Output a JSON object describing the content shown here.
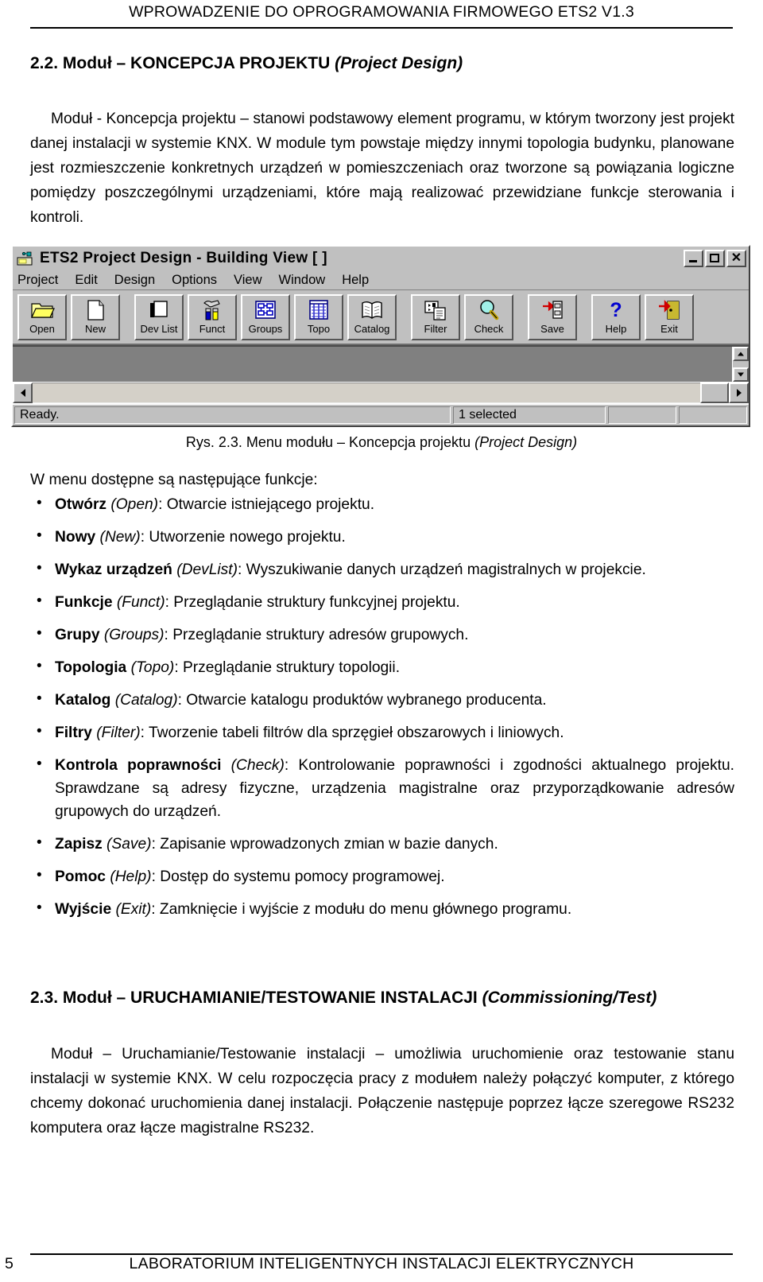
{
  "header": {
    "running_title": "WPROWADZENIE DO OPROGRAMOWANIA FIRMOWEGO  ETS2 V1.3"
  },
  "section_22": {
    "number": "2.2.",
    "title_pl": "Moduł – KONCEPCJA PROJEKTU",
    "title_en": "(Project Design)",
    "paragraph": "Moduł - Koncepcja projektu – stanowi podstawowy element programu, w którym tworzony jest projekt danej instalacji w systemie KNX. W module tym powstaje między innymi topologia budynku, planowane jest rozmieszczenie konkretnych urządzeń w pomieszczeniach oraz tworzone są powiązania logiczne pomiędzy poszczególnymi urządzeniami, które mają realizować przewidziane funkcje sterowania i kontroli."
  },
  "figure": {
    "caption_pl": "Rys. 2.3. Menu modułu – Koncepcja projektu ",
    "caption_en": "(Project Design)",
    "window": {
      "title": "ETS2 Project Design - Building View [ ]",
      "app_icon": "ets2-app-icon",
      "caption_buttons": [
        {
          "name": "minimize-button",
          "glyph": "minimize-icon"
        },
        {
          "name": "maximize-button",
          "glyph": "maximize-icon"
        },
        {
          "name": "close-button",
          "glyph": "close-icon",
          "label": "✕"
        }
      ],
      "menu": [
        {
          "label": "Project"
        },
        {
          "label": "Edit"
        },
        {
          "label": "Design"
        },
        {
          "label": "Options"
        },
        {
          "label": "View"
        },
        {
          "label": "Window"
        },
        {
          "label": "Help"
        }
      ],
      "toolbar": [
        {
          "label": "Open",
          "icon": "open-folder-icon"
        },
        {
          "label": "New",
          "icon": "new-document-icon"
        },
        {
          "separator_after": true
        },
        {
          "label": "Dev List",
          "icon": "device-list-icon"
        },
        {
          "label": "Funct",
          "icon": "function-tools-icon"
        },
        {
          "label": "Groups",
          "icon": "group-addresses-icon"
        },
        {
          "label": "Topo",
          "icon": "topology-grid-icon"
        },
        {
          "label": "Catalog",
          "icon": "catalog-book-icon"
        },
        {
          "separator_after": true
        },
        {
          "label": "Filter",
          "icon": "filter-table-icon"
        },
        {
          "label": "Check",
          "icon": "magnifier-check-icon"
        },
        {
          "separator_after": true
        },
        {
          "label": "Save",
          "icon": "save-disk-icon"
        },
        {
          "separator_after": true
        },
        {
          "label": "Help",
          "icon": "question-mark-icon"
        },
        {
          "label": "Exit",
          "icon": "exit-door-icon"
        }
      ],
      "statusbar": {
        "ready": "Ready.",
        "selection": "1 selected",
        "field_x": "",
        "field_y": ""
      },
      "colors": {
        "face": "#c0c0c0",
        "client": "#808080",
        "shadow": "#555555",
        "highlight": "#ffffff"
      }
    }
  },
  "menu_intro": "W menu dostępne są następujące funkcje:",
  "functions": [
    {
      "pl": "Otwórz ",
      "en": "(Open)",
      "desc": ": Otwarcie istniejącego projektu."
    },
    {
      "pl": "Nowy ",
      "en": "(New)",
      "desc": ": Utworzenie nowego projektu."
    },
    {
      "pl": "Wykaz urządzeń ",
      "en": "(DevList)",
      "desc": ": Wyszukiwanie danych urządzeń magistralnych w projekcie."
    },
    {
      "pl": "Funkcje ",
      "en": "(Funct)",
      "desc": ": Przeglądanie struktury funkcyjnej projektu."
    },
    {
      "pl": "Grupy ",
      "en": "(Groups)",
      "desc": ": Przeglądanie struktury adresów grupowych."
    },
    {
      "pl": "Topologia ",
      "en": "(Topo)",
      "desc": ": Przeglądanie struktury topologii."
    },
    {
      "pl": "Katalog ",
      "en": "(Catalog)",
      "desc": ": Otwarcie katalogu produktów wybranego producenta."
    },
    {
      "pl": "Filtry ",
      "en": "(Filter)",
      "desc": ": Tworzenie tabeli filtrów dla sprzęgieł obszarowych i liniowych."
    },
    {
      "pl": "Kontrola poprawności ",
      "en": "(Check)",
      "desc": ": Kontrolowanie poprawności i zgodności aktualnego projektu. Sprawdzane są adresy fizyczne, urządzenia magistralne oraz przyporządkowanie adresów grupowych do urządzeń."
    },
    {
      "pl": "Zapisz ",
      "en": "(Save)",
      "desc": ": Zapisanie wprowadzonych zmian w bazie danych."
    },
    {
      "pl": "Pomoc ",
      "en": "(Help)",
      "desc": ": Dostęp do systemu pomocy programowej."
    },
    {
      "pl": "Wyjście ",
      "en": "(Exit)",
      "desc": ": Zamknięcie i wyjście z modułu do menu głównego programu."
    }
  ],
  "section_23": {
    "number": "2.3.",
    "title_pl": "Moduł – URUCHAMIANIE/TESTOWANIE INSTALACJI",
    "title_en": "(Commissioning/Test)",
    "paragraph": "Moduł – Uruchamianie/Testowanie instalacji – umożliwia uruchomienie oraz testowanie stanu instalacji w systemie KNX. W celu rozpoczęcia pracy z modułem należy połączyć komputer, z którego chcemy dokonać uruchomienia danej instalacji. Połączenie następuje poprzez łącze szeregowe RS232 komputera oraz łącze magistralne RS232."
  },
  "footer": {
    "page_number": "5",
    "text": "LABORATORIUM  INTELIGENTNYCH  INSTALACJI  ELEKTRYCZNYCH"
  }
}
